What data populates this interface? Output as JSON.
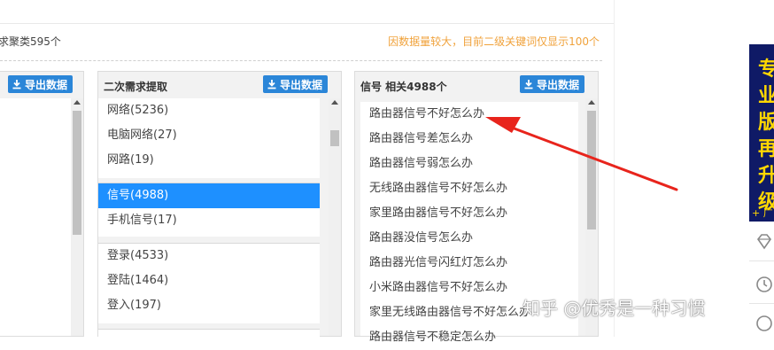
{
  "header": {
    "summary_left": "求聚类595个",
    "summary_right": "因数据量较大，目前二级关键词仅显示100个"
  },
  "col_left": {
    "export_label": "导出数据"
  },
  "col_mid": {
    "title": "二次需求提取",
    "export_label": "导出数据",
    "groups": [
      [
        "网络(5236)",
        "电脑网络(27)",
        "网路(19)"
      ],
      [
        "信号(4988)",
        "手机信号(17)"
      ],
      [
        "登录(4533)",
        "登陆(1464)",
        "登入(197)"
      ]
    ],
    "selected": "信号(4988)"
  },
  "col_right": {
    "title": "信号 相关4988个",
    "export_label": "导出数据",
    "items": [
      "路由器信号不好怎么办",
      "路由器信号差怎么办",
      "路由器信号弱怎么办",
      "无线路由器信号不好怎么办",
      "家里路由器信号不好怎么办",
      "路由器没信号怎么办",
      "路由器光信号闪红灯怎么办",
      "小米路由器信号不好怎么办",
      "家里无线路由器信号不好怎么办",
      "路由器信号不稳定怎么办"
    ]
  },
  "ad": {
    "chars": [
      "专",
      "业",
      "版",
      "再",
      "升",
      "级"
    ],
    "plus": "+ 广"
  },
  "watermark": "知乎 @优秀是一种习惯",
  "colors": {
    "accent": "#1e90ff",
    "button": "#2b86d8",
    "notice": "#f0a23b",
    "arrow": "#e8241c"
  }
}
